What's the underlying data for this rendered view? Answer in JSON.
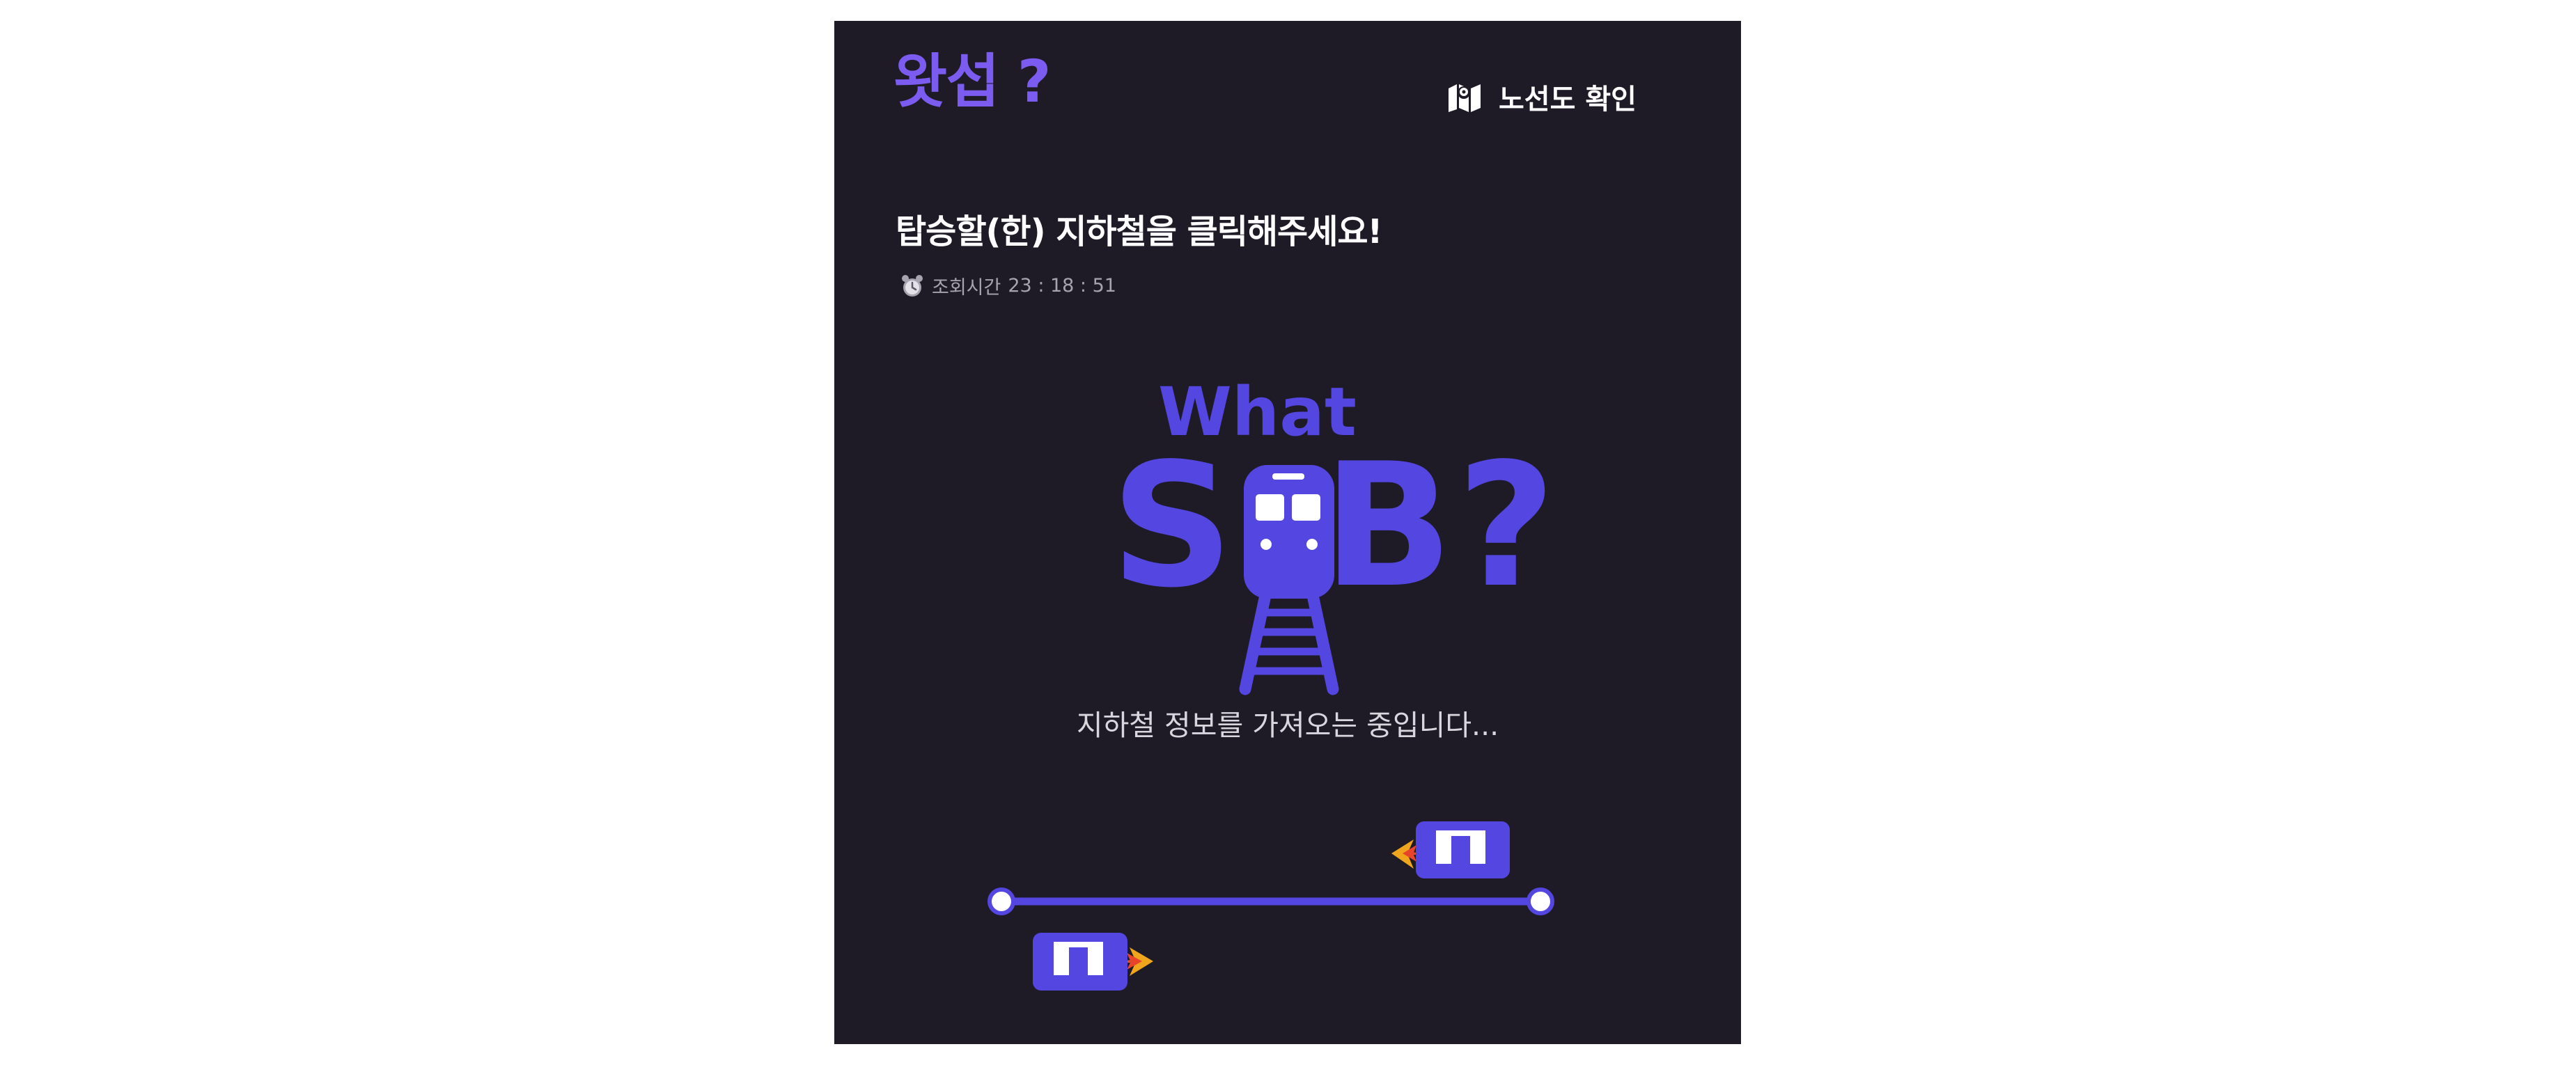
{
  "header": {
    "app_title": "왓섭 ?",
    "map_link_label": "노선도 확인",
    "map_icon": "map-icon"
  },
  "content": {
    "instruction": "탑승할(한) 지하철을 클릭해주세요!",
    "lookup_label": "조회시간",
    "lookup_time": "23 : 18 : 51",
    "clock_icon": "alarm-clock-icon"
  },
  "logo": {
    "top_text": "What",
    "letter_s": "S",
    "letter_b": "B",
    "question": "?",
    "train_icon": "subway-train-icon"
  },
  "loading": {
    "message": "지하철 정보를 가져오는 중입니다..."
  },
  "colors": {
    "background": "#1e1b27",
    "accent": "#5446e0",
    "title_purple": "#7c5cf0",
    "text": "#ffffff"
  }
}
